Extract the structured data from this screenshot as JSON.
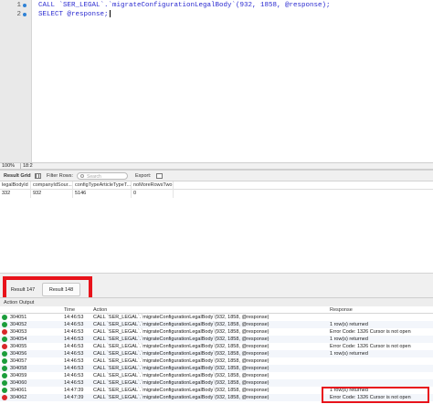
{
  "editor": {
    "lines": [
      {
        "number": "1",
        "code": "CALL `SER_LEGAL`.`migrateConfigurationLegalBody`(932, 1858, @response);"
      },
      {
        "number": "2",
        "code": "SELECT @response;"
      }
    ]
  },
  "zoombar": {
    "zoom": "100%",
    "position": "18:2"
  },
  "result_toolbar": {
    "title": "Result Grid",
    "filter_label": "Filter Rows:",
    "search_placeholder": "Search",
    "export_label": "Export:"
  },
  "result_grid": {
    "columns": [
      "legalBodyId",
      "companyIdSour...",
      "configTypeArticleTypeT...",
      "noMoreRowsTwo"
    ],
    "rows": [
      [
        "332",
        "932",
        "5146",
        "0"
      ]
    ]
  },
  "result_tabs": [
    {
      "label": "Result 147"
    },
    {
      "label": "Result 148"
    }
  ],
  "output": {
    "title": "Action Output",
    "columns": {
      "time": "Time",
      "action": "Action",
      "response": "Response"
    },
    "rows": [
      {
        "status": "ok",
        "num": "304051",
        "time": "14:46:53",
        "action": "CALL `SER_LEGAL`.`migrateConfigurationLegalBody`(932, 1858, @response)",
        "response": ""
      },
      {
        "status": "ok",
        "num": "304052",
        "time": "14:46:53",
        "action": "CALL `SER_LEGAL`.`migrateConfigurationLegalBody`(932, 1858, @response)",
        "response": "1 row(s) returned"
      },
      {
        "status": "err",
        "num": "304053",
        "time": "14:46:53",
        "action": "CALL `SER_LEGAL`.`migrateConfigurationLegalBody`(932, 1858, @response)",
        "response": "Error Code: 1326 Cursor is not open"
      },
      {
        "status": "ok",
        "num": "304054",
        "time": "14:46:53",
        "action": "CALL `SER_LEGAL`.`migrateConfigurationLegalBody`(932, 1858, @response)",
        "response": "1 row(s) returned"
      },
      {
        "status": "err",
        "num": "304055",
        "time": "14:46:53",
        "action": "CALL `SER_LEGAL`.`migrateConfigurationLegalBody`(932, 1858, @response)",
        "response": "Error Code: 1326 Cursor is not open"
      },
      {
        "status": "ok",
        "num": "304056",
        "time": "14:46:53",
        "action": "CALL `SER_LEGAL`.`migrateConfigurationLegalBody`(932, 1858, @response)",
        "response": "1 row(s) returned"
      },
      {
        "status": "ok",
        "num": "304057",
        "time": "14:46:53",
        "action": "CALL `SER_LEGAL`.`migrateConfigurationLegalBody`(932, 1858, @response)",
        "response": ""
      },
      {
        "status": "ok",
        "num": "304058",
        "time": "14:46:53",
        "action": "CALL `SER_LEGAL`.`migrateConfigurationLegalBody`(932, 1858, @response)",
        "response": ""
      },
      {
        "status": "ok",
        "num": "304059",
        "time": "14:46:53",
        "action": "CALL `SER_LEGAL`.`migrateConfigurationLegalBody`(932, 1858, @response)",
        "response": ""
      },
      {
        "status": "ok",
        "num": "304060",
        "time": "14:46:53",
        "action": "CALL `SER_LEGAL`.`migrateConfigurationLegalBody`(932, 1858, @response)",
        "response": ""
      },
      {
        "status": "ok",
        "num": "304061",
        "time": "14:47:39",
        "action": "CALL `SER_LEGAL`.`migrateConfigurationLegalBody`(932, 1858, @response)",
        "response": "1 row(s) returned"
      },
      {
        "status": "err",
        "num": "304062",
        "time": "14:47:39",
        "action": "CALL `SER_LEGAL`.`migrateConfigurationLegalBody`(932, 1858, @response)",
        "response": "Error Code: 1326 Cursor is not open"
      }
    ]
  },
  "colors": {
    "keyword": "#2a2ad0",
    "highlight": "#e8131b",
    "ok": "#1b9d3b",
    "error": "#d9272b"
  }
}
